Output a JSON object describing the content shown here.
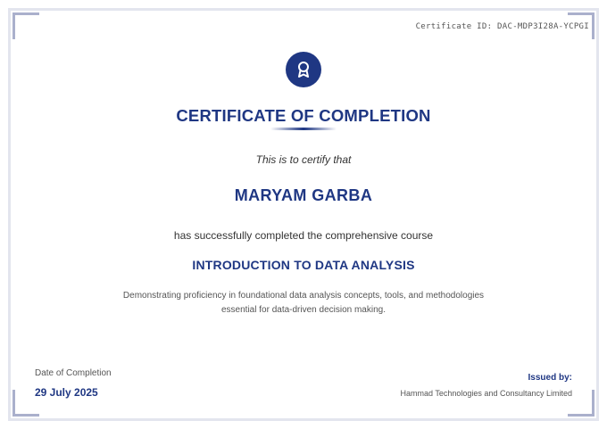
{
  "certificate": {
    "id_text": "Certificate ID: DAC-MDP3I28A-YCPGI",
    "badge_icon": "award-ribbon-icon",
    "title": "CERTIFICATE OF COMPLETION",
    "certify_line": "This is to certify that",
    "recipient_name": "MARYAM GARBA",
    "completed_line": "has successfully completed the comprehensive course",
    "course_name": "INTRODUCTION TO DATA ANALYSIS",
    "description_line1": "Demonstrating proficiency in foundational data analysis concepts, tools, and methodologies",
    "description_line2": "essential for data-driven decision making.",
    "date_label": "Date of Completion",
    "date_value": "29 July 2025",
    "issued_label": "Issued by:",
    "issuer_name": "Hammad Technologies and Consultancy Limited"
  },
  "colors": {
    "primary": "#1f3783",
    "frame": "#e3e5ee",
    "corner": "#aab0cc",
    "text": "#333333"
  }
}
